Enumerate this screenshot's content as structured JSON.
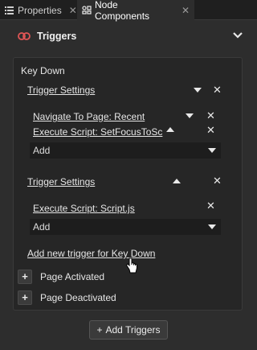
{
  "tabs": [
    {
      "label": "Properties",
      "icon": "list-icon",
      "active": false
    },
    {
      "label": "Node Components",
      "icon": "components-icon",
      "active": true
    }
  ],
  "tab_close_glyph": "✕",
  "section": {
    "title": "Triggers",
    "icon": "trigger-icon"
  },
  "key_down": {
    "title": "Key Down",
    "groups": [
      {
        "settings_label": "Trigger Settings",
        "actions": [
          {
            "label": "Navigate To Page: Recent"
          },
          {
            "label": "Execute Script: SetFocusToSc"
          }
        ],
        "add_placeholder": "Add"
      },
      {
        "settings_label": "Trigger Settings",
        "actions": [
          {
            "label": "Execute Script: Script.js"
          }
        ],
        "add_placeholder": "Add"
      }
    ],
    "add_trigger_link": "Add new trigger for Key Down"
  },
  "collapsed_triggers": [
    {
      "label": "Page Activated"
    },
    {
      "label": "Page Deactivated"
    }
  ],
  "plus_glyph": "+",
  "close_glyph": "✕",
  "add_triggers_button": {
    "label": "Add Triggers",
    "glyph": "+"
  },
  "colors": {
    "background": "#2d2d2d",
    "panel": "#262626",
    "tabbar": "#1f1f1f",
    "accent_trigger": "#e05555"
  }
}
